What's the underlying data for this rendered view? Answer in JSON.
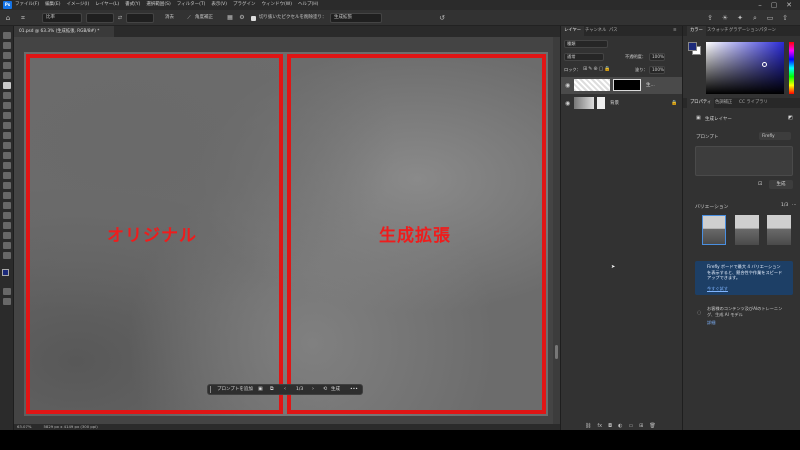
{
  "menubar": {
    "app_icon": "Ps",
    "menus": [
      "ファイル(F)",
      "編集(E)",
      "イメージ(I)",
      "レイヤー(L)",
      "書式(Y)",
      "選択範囲(S)",
      "フィルター(T)",
      "表示(V)",
      "プラグイン",
      "ウィンドウ(W)",
      "ヘルプ(H)"
    ]
  },
  "options": {
    "ratio_select": "比率",
    "clear_label": "消去",
    "straighten_label": "角度補正",
    "delete_cropped_label": "切り抜いたピクセルを削除",
    "fill_label": "塗り：",
    "fill_value": "生成拡張"
  },
  "document": {
    "tab_title": "01.psd @ 63.3% (生成拡張, RGB/8#) *",
    "label_original": "オリジナル",
    "label_generated": "生成拡張",
    "contextbar": {
      "prompt_placeholder": "プロンプトを追加",
      "page": "1/3",
      "generate_label": "生成"
    },
    "status_zoom": "63.07%",
    "status_info": "5829 px x 4149 px (300 ppi)"
  },
  "layers_panel": {
    "tabs": [
      "レイヤー",
      "チャンネル",
      "パス"
    ],
    "kind_filter": "種類",
    "blend_mode": "通常",
    "opacity_label": "不透明度：",
    "opacity_value": "100%",
    "lock_label": "ロック：",
    "fill_label": "塗り：",
    "fill_value": "100%",
    "layers": [
      {
        "name": "生...",
        "has_mask": true
      },
      {
        "name": "背景",
        "locked": true
      }
    ]
  },
  "color_panel": {
    "tabs": [
      "カラー",
      "スウォッチ",
      "グラデーション",
      "パターン"
    ],
    "foreground": "#1c2a7a",
    "background": "#ffffff"
  },
  "properties_panel": {
    "tabs": [
      "プロパティ",
      "色調補正",
      "CC ライブラリ"
    ],
    "layer_type": "生成レイヤー",
    "prompt_label": "プロンプト",
    "model_label": "Firefly",
    "generate_label": "生成",
    "variations_label": "バリエーション",
    "variations_count": "1/3",
    "notice_text": "Firefly ボードで最大 4 バリエーションを表示すると、競合性や作業をスピードアップできます。",
    "notice_link": "今すぐ試す",
    "footer_text": "お客様のコンテンツ及びAIのトレーニング、生成 AI モデル",
    "footer_link": "詳細"
  }
}
